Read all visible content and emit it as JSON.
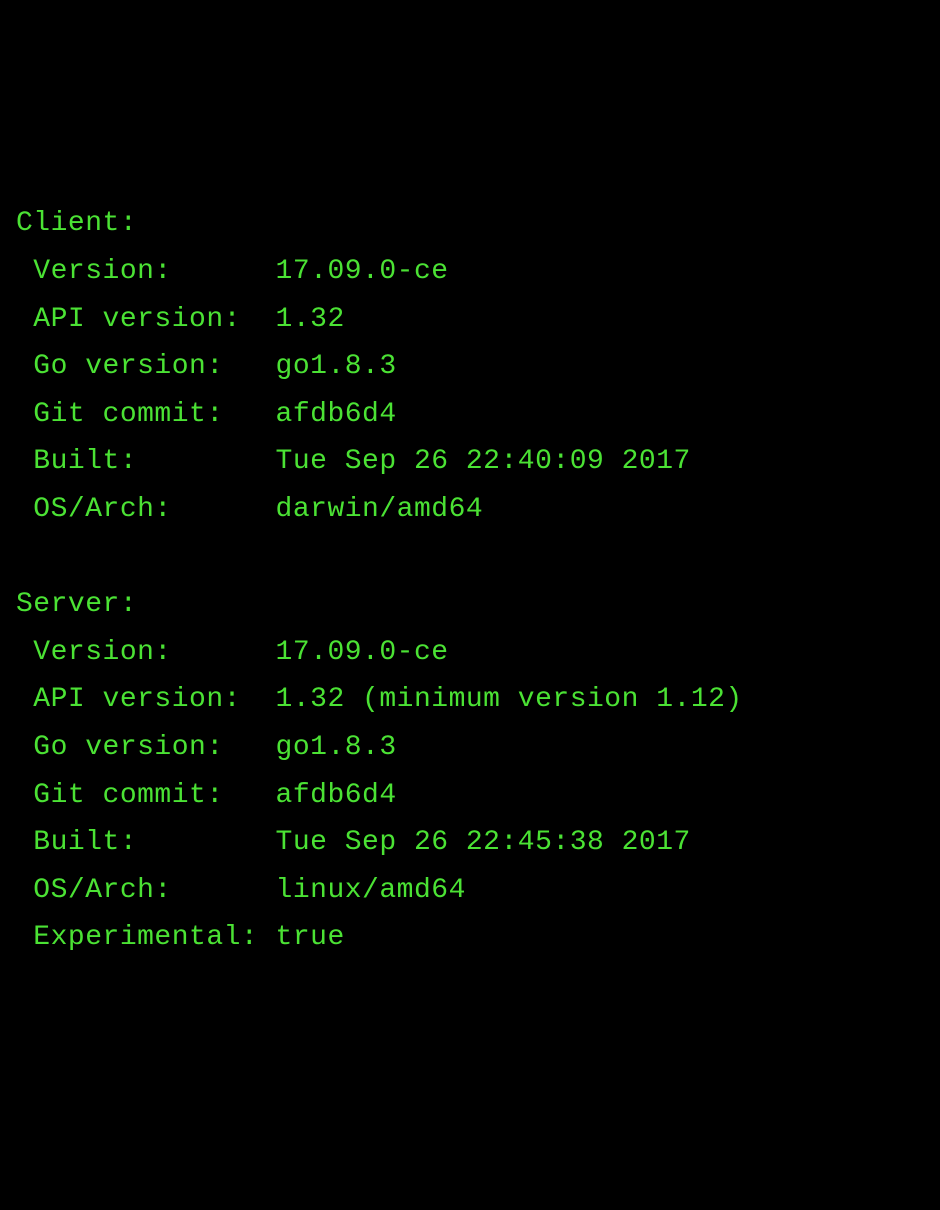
{
  "client": {
    "header": "Client:",
    "version_label": " Version:      ",
    "version_value": "17.09.0-ce",
    "api_version_label": " API version:  ",
    "api_version_value": "1.32",
    "go_version_label": " Go version:   ",
    "go_version_value": "go1.8.3",
    "git_commit_label": " Git commit:   ",
    "git_commit_value": "afdb6d4",
    "built_label": " Built:        ",
    "built_value": "Tue Sep 26 22:40:09 2017",
    "os_arch_label": " OS/Arch:      ",
    "os_arch_value": "darwin/amd64"
  },
  "server": {
    "header": "Server:",
    "version_label": " Version:      ",
    "version_value": "17.09.0-ce",
    "api_version_label": " API version:  ",
    "api_version_value": "1.32 (minimum version 1.12)",
    "go_version_label": " Go version:   ",
    "go_version_value": "go1.8.3",
    "git_commit_label": " Git commit:   ",
    "git_commit_value": "afdb6d4",
    "built_label": " Built:        ",
    "built_value": "Tue Sep 26 22:45:38 2017",
    "os_arch_label": " OS/Arch:      ",
    "os_arch_value": "linux/amd64",
    "experimental_label": " Experimental: ",
    "experimental_value": "true"
  }
}
